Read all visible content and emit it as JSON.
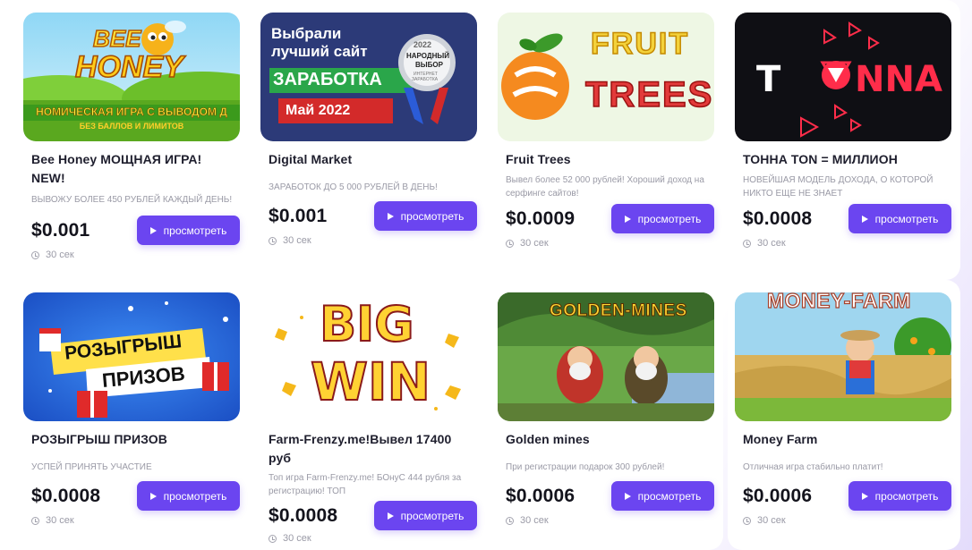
{
  "cards": [
    {
      "title": "Bee Honey МОЩНАЯ ИГРА! NEW!",
      "description": "ВЫВОЖУ БОЛЕЕ 450 РУБЛЕЙ КАЖДЫЙ ДЕНЬ!",
      "price": "$0.001",
      "button_label": "просмотреть",
      "time": "30 сек",
      "banner": {
        "line1": "BEE",
        "line2": "HONEY",
        "ticker1": "НОМИЧЕСКАЯ ИГРА С ВЫВОДОМ Д",
        "ticker2": "БЕЗ БАЛЛОВ И ЛИМИТОВ"
      }
    },
    {
      "title": "Digital Market",
      "description": "ЗАРАБОТОК ДО 5 000 РУБЛЕЙ В ДЕНЬ!",
      "price": "$0.001",
      "button_label": "просмотреть",
      "time": "30 сек",
      "banner": {
        "line1": "Выбрали",
        "line2": "лучший сайт",
        "line3": "ЗАРАБОТКА",
        "line4": "Май 2022",
        "badge_year": "2022",
        "badge_line1": "НАРОДНЫЙ",
        "badge_line2": "ВЫБОР",
        "badge_line3": "ИНТЕРНЕТ",
        "badge_line4": "ЗАРАБОТКА"
      }
    },
    {
      "title": "Fruit Trees",
      "description": "Вывел более 52 000 рублей! Хороший доход на серфинге сайтов!",
      "price": "$0.0009",
      "button_label": "просмотреть",
      "time": "30 сек",
      "banner": {
        "line1": "FRUIT",
        "line2": "TREES"
      }
    },
    {
      "title": "ТОННА TON = МИЛЛИОН",
      "description": "НОВЕЙШАЯ МОДЕЛЬ ДОХОДА, О КОТОРОЙ НИКТО ЕЩЕ НЕ ЗНАЕТ",
      "price": "$0.0008",
      "button_label": "просмотреть",
      "time": "30 сек",
      "banner": {
        "part1": "T",
        "part2": "NNA"
      }
    },
    {
      "title": "РОЗЫГРЫШ ПРИЗОВ",
      "description": "УСПЕЙ ПРИНЯТЬ УЧАСТИЕ",
      "price": "$0.0008",
      "button_label": "просмотреть",
      "time": "30 сек",
      "banner": {
        "line1": "РОЗЫГРЫШ",
        "line2": "ПРИЗОВ"
      }
    },
    {
      "title": "Farm-Frenzy.me!Вывел 17400 руб",
      "description": "Топ игра Farm-Frenzy.me! БОнуС 444 рубля за регистрацию! ТОП",
      "price": "$0.0008",
      "button_label": "просмотреть",
      "time": "30 сек",
      "banner": {
        "line1": "BIG",
        "line2": "WIN"
      }
    },
    {
      "title": "Golden mines",
      "description": "При регистрации подарок 300 рублей!",
      "price": "$0.0006",
      "button_label": "просмотреть",
      "time": "30 сек",
      "banner": {
        "line1": "GOLDEN-MINES"
      }
    },
    {
      "title": "Money Farm",
      "description": "Отличная игра стабильно платит!",
      "price": "$0.0006",
      "button_label": "просмотреть",
      "time": "30 сек",
      "banner": {
        "line1": "MONEY-FARM"
      }
    }
  ],
  "colors": {
    "accent": "#6b45f0",
    "price": "#13131c",
    "muted": "#9a9aa6"
  },
  "icons": {
    "button": "play-icon",
    "time": "clock-icon"
  }
}
